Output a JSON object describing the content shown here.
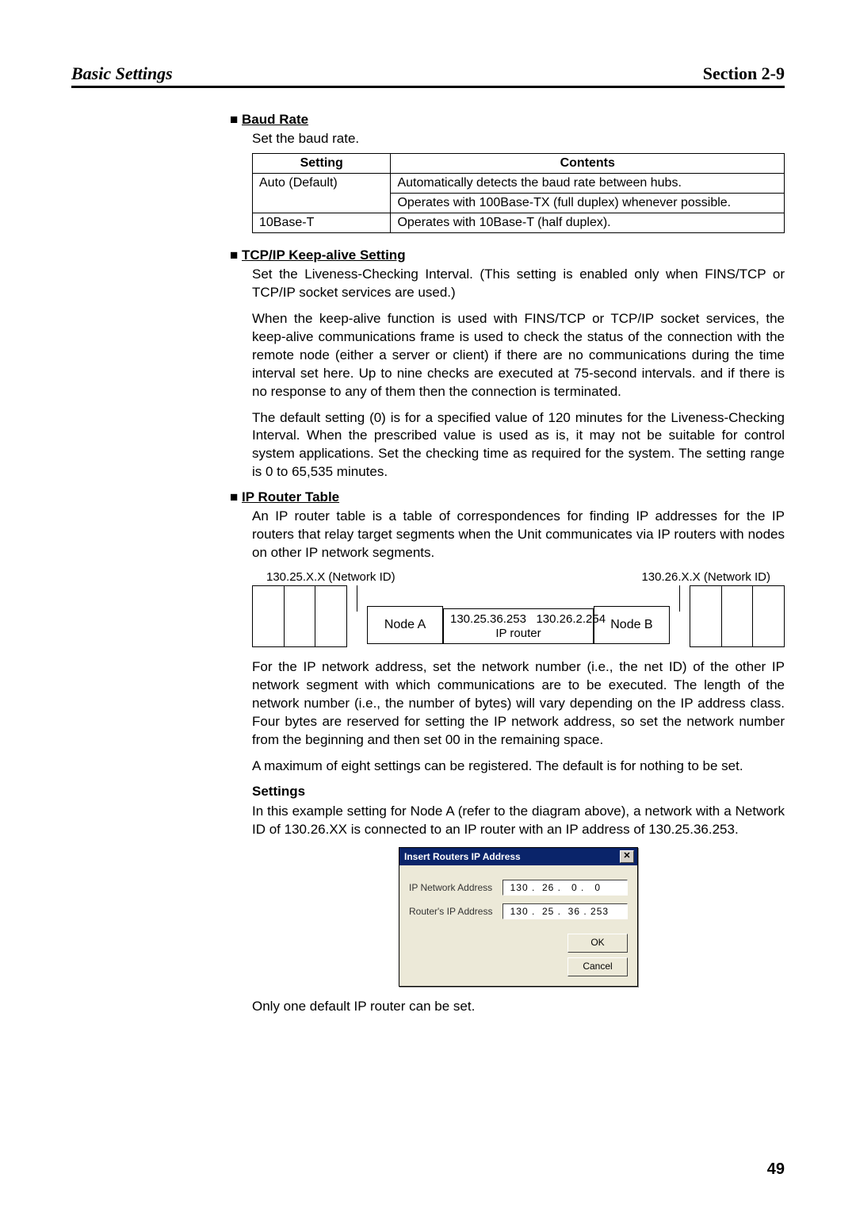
{
  "header": {
    "left": "Basic Settings",
    "right": "Section 2-9"
  },
  "baud_rate": {
    "heading": "Baud Rate",
    "intro": "Set the baud rate.",
    "table": {
      "head_setting": "Setting",
      "head_contents": "Contents",
      "rows": [
        {
          "setting": "Auto (Default)",
          "contents1": "Automatically detects the baud rate between hubs.",
          "contents2": "Operates with 100Base-TX (full duplex) whenever possible."
        },
        {
          "setting": "10Base-T",
          "contents1": "Operates with 10Base-T (half duplex).",
          "contents2": ""
        }
      ]
    }
  },
  "keepalive": {
    "heading": "TCP/IP Keep-alive Setting",
    "p1": "Set the Liveness-Checking Interval. (This setting is enabled only when FINS/TCP or TCP/IP socket services are used.)",
    "p2": "When the keep-alive function is used with FINS/TCP or TCP/IP socket services, the keep-alive communications frame is used to check the status of the connection with the remote node (either a server or client) if there are no communications during the time interval set here. Up to nine checks are executed at 75-second intervals. and if there is no response to any of them then the connection is terminated.",
    "p3": "The default setting (0) is for a specified value of 120 minutes for the Liveness-Checking Interval. When the prescribed value is used as is, it may not be suitable for control system applications. Set the checking time as required for the system. The setting range is 0 to 65,535 minutes."
  },
  "router": {
    "heading": "IP Router Table",
    "p1": "An IP router table is a table of correspondences for finding IP addresses for the IP routers that relay target segments when the Unit communicates via IP routers with nodes on other IP network segments.",
    "diagram": {
      "net_left": "130.25.X.X (Network ID)",
      "net_right": "130.26.X.X (Network ID)",
      "node_a": "Node A",
      "node_b": "Node B",
      "ip_left": "130.25.36.253",
      "ip_right": "130.26.2.254",
      "ip_router_label": "IP router"
    },
    "p2": "For the IP network address, set the network number (i.e., the net ID) of the other IP network segment with which communications are to be executed. The length of the network number (i.e., the number of bytes) will vary depending on the IP address class. Four bytes are reserved for setting the IP network address, so set the network number from the beginning and then set 00 in the remaining space.",
    "p3": "A maximum of eight settings can be registered. The default is for nothing to be set.",
    "settings_label": "Settings",
    "p4": "In this example setting for Node A (refer to the diagram above), a network with a Network ID of 130.26.XX is connected to an IP router with an IP address of 130.25.36.253.",
    "dialog": {
      "title": "Insert Routers IP Address",
      "close_glyph": "✕",
      "label_ipnet": "IP Network Address",
      "label_router": "Router's IP Address",
      "val_ipnet": " 130 .  26 .   0 .   0",
      "val_router": " 130 .  25 .  36 . 253",
      "ok": "OK",
      "cancel": "Cancel"
    },
    "p5": "Only one default IP router can be set."
  },
  "page_number": "49"
}
